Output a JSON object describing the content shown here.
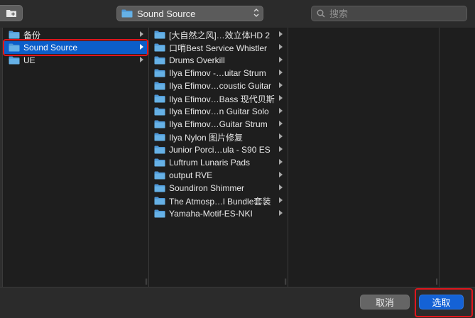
{
  "toolbar": {
    "new_folder_icon": "new-folder-icon",
    "path_popup_label": "Sound Source",
    "search_placeholder": "搜索"
  },
  "column1": {
    "items": [
      {
        "label": "备份",
        "selected": false
      },
      {
        "label": "Sound Source",
        "selected": true
      },
      {
        "label": "UE",
        "selected": false
      }
    ]
  },
  "column2": {
    "items": [
      {
        "label": "[大自然之风]…效立体HD 2"
      },
      {
        "label": "口哨Best Service Whistler"
      },
      {
        "label": "Drums Overkill"
      },
      {
        "label": "Ilya Efimov -…uitar Strum"
      },
      {
        "label": "Ilya Efimov…coustic Guitar"
      },
      {
        "label": "Ilya Efimov…Bass 现代贝斯"
      },
      {
        "label": "Ilya Efimov…n Guitar Solo"
      },
      {
        "label": "Ilya Efimov…Guitar Strum"
      },
      {
        "label": "Ilya Nylon 图片修复"
      },
      {
        "label": "Junior Porci…ula - S90 ES"
      },
      {
        "label": "Luftrum Lunaris Pads"
      },
      {
        "label": "output RVE"
      },
      {
        "label": "Soundiron Shimmer"
      },
      {
        "label": "The Atmosp…l Bundle套装"
      },
      {
        "label": "Yamaha-Motif-ES-NKI"
      }
    ]
  },
  "buttons": {
    "cancel": "取消",
    "choose": "选取"
  },
  "colors": {
    "selection": "#0b5ec9",
    "primary_button": "#1462d6",
    "annotation_red": "#e0161d",
    "folder_blue": "#5aa5dc"
  }
}
